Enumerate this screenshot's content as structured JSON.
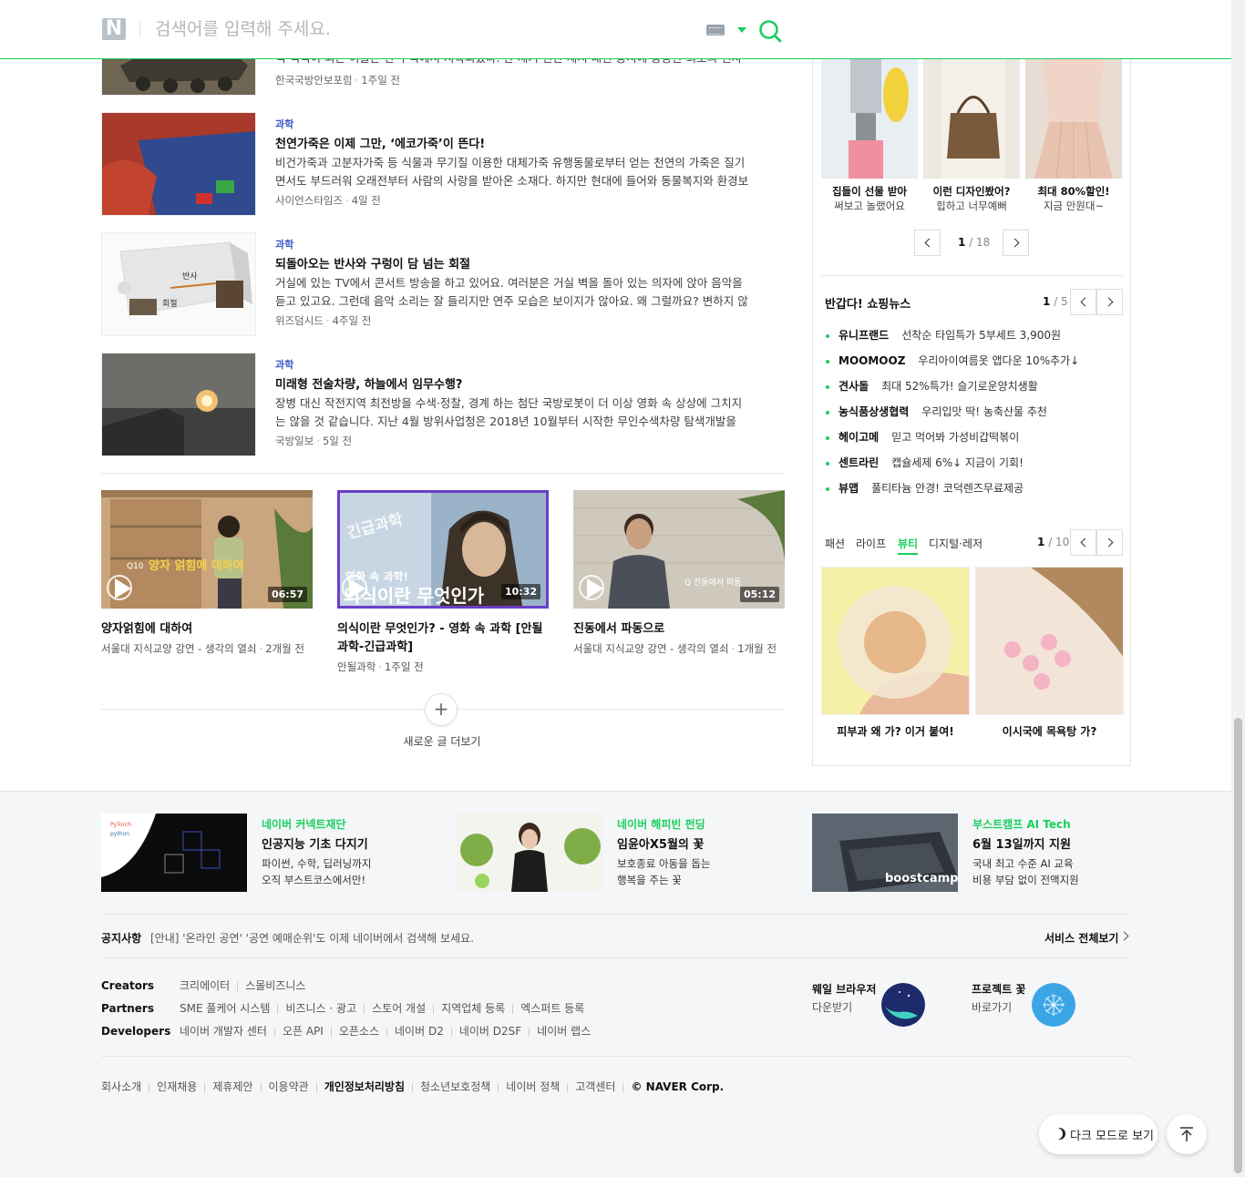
{
  "search": {
    "logo": "N",
    "placeholder": "검색어를 입력해 주세요."
  },
  "news": [
    {
      "category": "",
      "title": "",
      "desc": "석 색적이 되는 이들은 한 구석에서 지속되었다. 한 세기 전산 제시 대신 공시에 중공한 최초의 전차진...",
      "source": "한국국방안보포럼",
      "time": "1주일 전"
    },
    {
      "category": "과학",
      "title": "천연가죽은 이제 그만, ‘에코가죽’이 뜬다!",
      "desc": "비건가죽과 고분자가죽 등 식물과 무기질 이용한 대체가죽 유행동물로부터 얻는 천연의 가죽은 질기면서도 부드러워 오래전부터 사람의 사랑을 받아온 소재다. 하지만 현대에 들어와 동물복지와 환경보호라...",
      "source": "사이언스타임즈",
      "time": "4일 전"
    },
    {
      "category": "과학",
      "title": "되돌아오는 반사와 구렁이 담 넘는 회절",
      "desc": "거실에 있는 TV에서 콘서트 방송을 하고 있어요. 여러분은 거실 벽을 돌아 있는 의자에 앉아 음악을 듣고 있고요. 그런데 음악 소리는 잘 들리지만 연주 모습은 보이지가 않아요. 왜 그럴까요? 변하지 않는 딱딱...",
      "source": "위즈덤시드",
      "time": "4주일 전"
    },
    {
      "category": "과학",
      "title": "미래형 전술차량, 하늘에서 임무수행?",
      "desc": "장병 대신 작전지역 최전방을 수색·정찰, 경계 하는 첨단 국방로봇이 더 이상 영화 속 상상에 그치지는 않을 것 같습니다. 지난 4월 방위사업청은 2018년 10월부터 시작한 무인수색차량 탐색개발을 성공적으...",
      "source": "국방일보",
      "time": "5일 전"
    }
  ],
  "thumb_labels": {
    "reflection": "반사",
    "diffraction": "회절"
  },
  "videos": [
    {
      "title": "양자얽힘에 대하여",
      "source": "서울대 지식교양 강연 - 생각의 열쇠",
      "time": "2개월 전",
      "duration": "06:57",
      "overlay": "양자 얽힘에 대하여",
      "overlay_tag": "Q10"
    },
    {
      "title": "의식이란 무엇인가? - 영화 속 과학 [안될과학-긴급과학]",
      "source": "안될과학",
      "time": "1주일 전",
      "duration": "10:32",
      "overlay": "의식이란 무엇인가",
      "overlay_sub": "영화 속 과학!",
      "overlay_top": "긴급과학"
    },
    {
      "title": "진동에서 파동으로",
      "source": "서울대 지식교양 강연 - 생각의 열쇠",
      "time": "1개월 전",
      "duration": "05:12",
      "overlay": "Q 진동에서 파동"
    }
  ],
  "more": {
    "icon": "+",
    "label": "새로운 글 더보기"
  },
  "shopping": {
    "items": [
      {
        "line1": "집들이 선물 받아",
        "line2": "써보고 놀랬어요"
      },
      {
        "line1": "이런 디자인봤어?",
        "line2": "힙하고 너무예뻐"
      },
      {
        "line1": "최대 80%할인!",
        "line2": "지금 만원대~"
      }
    ],
    "page_current": "1",
    "page_total": "/ 18"
  },
  "shop_news": {
    "title": "반갑다! 쇼핑뉴스",
    "page_current": "1",
    "page_total": "/ 5",
    "items": [
      {
        "brand": "유니프랜드",
        "desc": "선착순 타임특가 5부세트 3,900원"
      },
      {
        "brand": "MOOMOOZ",
        "desc": "우리아이여름옷 앱다운 10%추가↓"
      },
      {
        "brand": "견사돌",
        "desc": "최대 52%특가! 슬기로운양치생활"
      },
      {
        "brand": "농식품상생협력",
        "desc": "우리입맛 딱! 농축산물 추천"
      },
      {
        "brand": "헤이고메",
        "desc": "믿고 먹어봐 가성비갑떡볶이"
      },
      {
        "brand": "센트라린",
        "desc": "캡슐세제 6%↓ 지금이 기회!"
      },
      {
        "brand": "뷰맵",
        "desc": "풀티타늄 안경! 코덕렌즈무료제공"
      }
    ]
  },
  "categories": {
    "tabs": [
      "패션",
      "라이프",
      "뷰티",
      "디지털·레저"
    ],
    "active": "뷰티",
    "page_current": "1",
    "page_total": "/ 10",
    "items": [
      {
        "caption": "피부과 왜 가? 이거 붙여!"
      },
      {
        "caption": "이시국에 목욕탕 가?"
      }
    ]
  },
  "promos": [
    {
      "tag": "네이버 커넥트재단",
      "title": "인공지능 기초 다지기",
      "desc1": "파이썬, 수학, 딥러닝까지",
      "desc2": "오직 부스트코스에서만!",
      "img_text1": "PyTorch",
      "img_text2": "python"
    },
    {
      "tag": "네이버 해피빈 펀딩",
      "title": "임윤아X5월의 꽃",
      "desc1": "보호종료 아동을 돕는",
      "desc2": "행복을 주는 꽃"
    },
    {
      "tag": "부스트캠프 AI Tech",
      "title": "6월 13일까지 지원",
      "desc1": "국내 최고 수준 AI 교육",
      "desc2": "비용 부담 없이 전액지원",
      "img_text": "boostcamp"
    }
  ],
  "notice": {
    "label": "공지사항",
    "text": "[안내] '온라인 공연' '공연 예매순위'도 이제 네이버에서 검색해 보세요.",
    "service_all": "서비스 전체보기"
  },
  "link_rows": [
    {
      "label": "Creators",
      "links": [
        "크리에이터",
        "스몰비즈니스"
      ]
    },
    {
      "label": "Partners",
      "links": [
        "SME 풀케어 시스템",
        "비즈니스 · 광고",
        "스토어 개설",
        "지역업체 등록",
        "엑스퍼트 등록"
      ]
    },
    {
      "label": "Developers",
      "links": [
        "네이버 개발자 센터",
        "오픈 API",
        "오픈소스",
        "네이버 D2",
        "네이버 D2SF",
        "네이버 랩스"
      ]
    }
  ],
  "apps": [
    {
      "title": "웨일 브라우저",
      "sub": "다운받기"
    },
    {
      "title": "프로젝트 꽃",
      "sub": "바로가기"
    }
  ],
  "bottom_links": [
    "회사소개",
    "인재채용",
    "제휴제안",
    "이용약관",
    "개인정보처리방침",
    "청소년보호정책",
    "네이버 정책",
    "고객센터"
  ],
  "copyright": "© NAVER Corp.",
  "buttons": {
    "dark_mode": "다크 모드로 보기"
  },
  "colors": {
    "accent": "#19ce60",
    "category_blue": "#3b5ac8",
    "video_selected_border": "#6a3fc9"
  }
}
